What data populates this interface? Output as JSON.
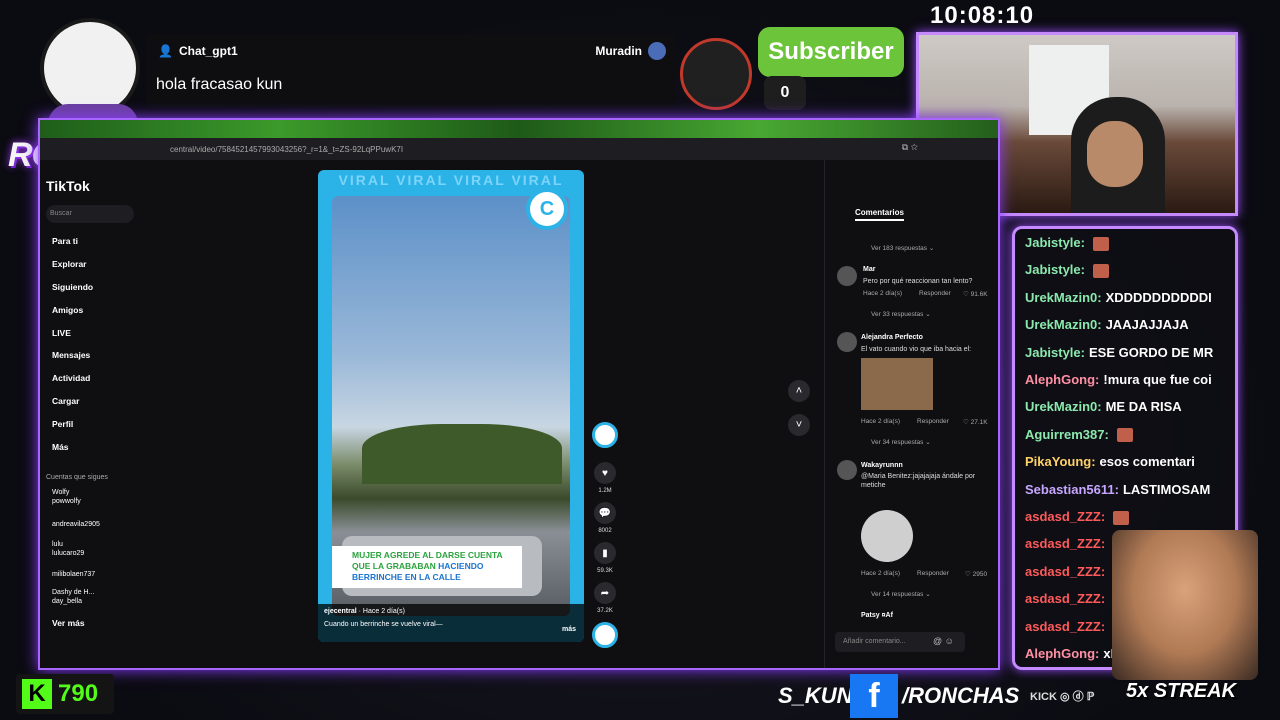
{
  "overlay": {
    "logo_text": "RONCHAS",
    "top_chat": {
      "user": "Chat_gpt1",
      "sender": "Muradin",
      "message": "hola fracasao kun"
    },
    "subscriber": {
      "label": "Subscriber",
      "count": "0"
    },
    "clock": "10:08:10"
  },
  "browser": {
    "url": "central/video/7584521457993043256?_r=1&_t=ZS-92LqPPuwK7I"
  },
  "tiktok": {
    "title": "TikTok",
    "search_placeholder": "Buscar",
    "nav": [
      "Para ti",
      "Explorar",
      "Siguiendo",
      "Amigos",
      "LIVE",
      "Mensajes",
      "Actividad",
      "Cargar",
      "Perfil",
      "Más"
    ],
    "following_header": "Cuentas que sigues",
    "accounts": [
      {
        "line1": "Wolfy",
        "line2": "powwolfy"
      },
      {
        "line1": "andreavila2905",
        "line2": ""
      },
      {
        "line1": "lulu",
        "line2": "lulucaro29"
      },
      {
        "line1": "milibolaen737",
        "line2": ""
      },
      {
        "line1": "Dashy de H...",
        "line2": "day_bella"
      }
    ],
    "see_more": "Ver más",
    "video": {
      "watermark": "VIRAL VIRAL VIRAL VIRAL",
      "caption_green_1": "MUJER AGREDE AL DARSE CUENTA",
      "caption_green_2": "QUE LA GRABABAN",
      "caption_blue": "HACIENDO",
      "caption_blue_2": "BERRINCHE EN LA CALLE",
      "author": "ejecentral",
      "time": "Hace 2 día(s)",
      "description": "Cuando un berrinche se vuelve viral—",
      "more": "más"
    },
    "actions": {
      "likes": "1.2M",
      "comments": "8002",
      "saves": "59.3K",
      "shares": "37.2K"
    },
    "comments_tab": "Comentarios",
    "comments": [
      {
        "type": "replies",
        "text": "Ver 183 respuestas ⌄"
      },
      {
        "name": "Mar",
        "text": "Pero por qué reaccionan tan lento?",
        "time": "Hace 2 día(s)",
        "reply": "Responder",
        "likes": "91.6K"
      },
      {
        "type": "replies",
        "text": "Ver 33 respuestas ⌄"
      },
      {
        "name": "Alejandra Perfecto",
        "text": "El vato cuando vio que iba hacia el:",
        "time": "Hace 2 día(s)",
        "reply": "Responder",
        "likes": "27.1K"
      },
      {
        "type": "replies",
        "text": "Ver 34 respuestas ⌄"
      },
      {
        "name": "Wakayrunnn",
        "text": "@Maria Benitez:jajajajaja ándale por metiche",
        "time": "Hace 2 día(s)",
        "reply": "Responder",
        "likes": "2950"
      },
      {
        "type": "replies",
        "text": "Ver 14 respuestas ⌄"
      },
      {
        "name": "Patsy ¤Af",
        "text": ""
      }
    ],
    "add_comment": "Añadir comentario..."
  },
  "stream_chat": [
    {
      "user": "Jabistyle:",
      "msg": "",
      "color": "#8be9ae",
      "emote": true
    },
    {
      "user": "Jabistyle:",
      "msg": "",
      "color": "#8be9ae",
      "emote": true
    },
    {
      "user": "UrekMazin0:",
      "msg": "XDDDDDDDDDDI",
      "color": "#8be9ae",
      "emote": false
    },
    {
      "user": "UrekMazin0:",
      "msg": "JAAJAJJAJA",
      "color": "#8be9ae",
      "emote": false
    },
    {
      "user": "Jabistyle:",
      "msg": "ESE GORDO DE MR",
      "color": "#8be9ae",
      "emote": false
    },
    {
      "user": "AlephGong:",
      "msg": "!mura que fue coi",
      "color": "#ff8fa3",
      "emote": false
    },
    {
      "user": "UrekMazin0:",
      "msg": "ME DA RISA",
      "color": "#8be9ae",
      "emote": false
    },
    {
      "user": "Aguirrem387:",
      "msg": "",
      "color": "#8be9ae",
      "emote": true
    },
    {
      "user": "PikaYoung:",
      "msg": "esos comentari",
      "color": "#ffd166",
      "emote": false
    },
    {
      "user": "Sebastian5611:",
      "msg": "LASTIMOSAM",
      "color": "#c7a6ff",
      "emote": false
    },
    {
      "user": "asdasd_ZZZ:",
      "msg": "",
      "color": "#ff5a5a",
      "emote": true
    },
    {
      "user": "asdasd_ZZZ:",
      "msg": "",
      "color": "#ff5a5a",
      "emote": false
    },
    {
      "user": "asdasd_ZZZ:",
      "msg": "",
      "color": "#ff5a5a",
      "emote": false
    },
    {
      "user": "asdasd_ZZZ:",
      "msg": "",
      "color": "#ff5a5a",
      "emote": false
    },
    {
      "user": "asdasd_ZZZ:",
      "msg": "",
      "color": "#ff5a5a",
      "emote": false
    },
    {
      "user": "AlephGong:",
      "msg": "xD",
      "color": "#ff8fa3",
      "emote": false
    }
  ],
  "bottom": {
    "kick_count": "790",
    "handle_left": "S_KUN",
    "handle_right": "/RONCHAS",
    "platforms": "KICK ◎ ⓓ ℙ",
    "streak": "5x STREAK"
  },
  "colors": {
    "accent": "#a866ff",
    "kick_green": "#53fc18",
    "subscriber_green": "#6cc43a",
    "facebook_blue": "#1877f2"
  }
}
